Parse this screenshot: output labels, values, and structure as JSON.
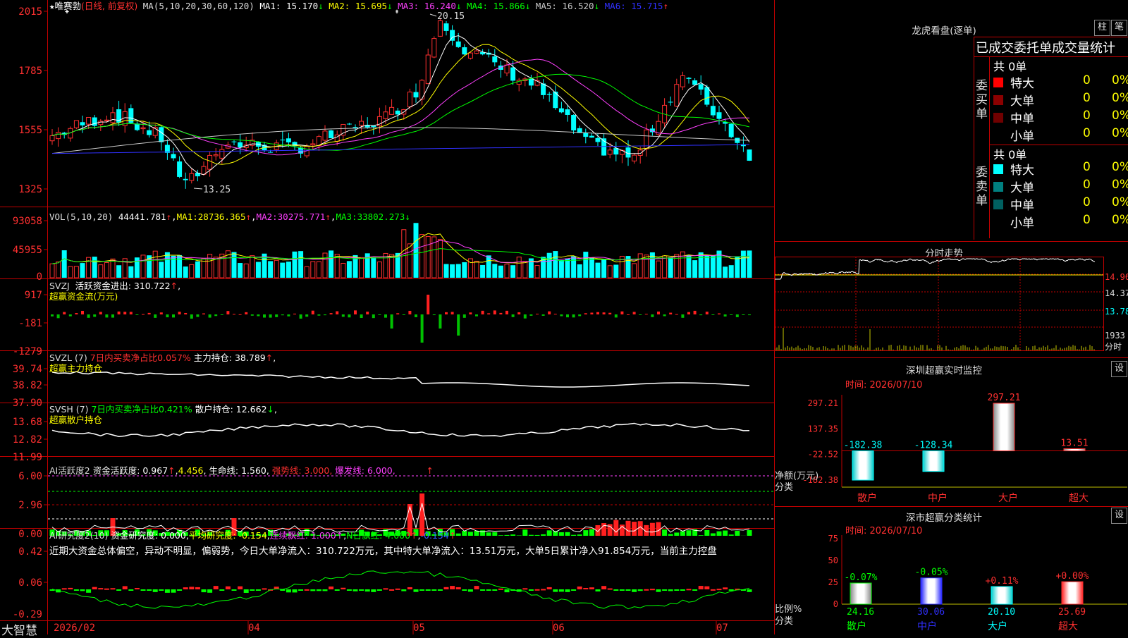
{
  "app": {
    "logo": "大智慧"
  },
  "kline": {
    "stock_name": "唯赛勃",
    "period": "(日线, 前复权)",
    "ma_label": "MA(5,10,20,30,60,120)",
    "ma": [
      {
        "label": "MA1:",
        "value": "15.170",
        "arrow": "↓",
        "color": "#ffffff"
      },
      {
        "label": "MA2:",
        "value": "15.695",
        "arrow": "↓",
        "color": "#ffff00"
      },
      {
        "label": "MA3:",
        "value": "16.240",
        "arrow": "↓",
        "color": "#ff40ff"
      },
      {
        "label": "MA4:",
        "value": "15.866",
        "arrow": "↓",
        "color": "#00ff00"
      },
      {
        "label": "MA5:",
        "value": "16.520",
        "arrow": "↓",
        "color": "#c8c8c8"
      },
      {
        "label": "MA6:",
        "value": "15.715",
        "arrow": "↑",
        "color": "#3030ff"
      }
    ],
    "y_ticks": [
      "2015",
      "1785",
      "1555",
      "1325"
    ],
    "high_label": "20.15",
    "low_label": "13.25"
  },
  "vol": {
    "label": "VOL(5,10,20)",
    "value": "44441.781",
    "ma1_label": "MA1:",
    "ma1": "28736.365",
    "ma2_label": "MA2:",
    "ma2": "30275.771",
    "ma3_label": "MA3:",
    "ma3": "33802.273",
    "y_ticks": [
      "93058",
      "45955",
      "0"
    ]
  },
  "svzj": {
    "label": "SVZJ",
    "text": "活跃资金进出: 310.722",
    "subtitle": "超赢资金流(万元)",
    "y_ticks": [
      "917",
      "-181",
      "-1279"
    ]
  },
  "svzl": {
    "label": "SVZL (7)",
    "red_text": "7日内买卖净占比0.057%",
    "white_text": "主力持仓: 38.789",
    "subtitle": "超赢主力持仓",
    "y_ticks": [
      "39.74",
      "38.82",
      "37.90"
    ]
  },
  "svsh": {
    "label": "SVSH (7)",
    "green_text": "7日内买卖净占比0.421%",
    "white_text": "散户持仓: 12.662",
    "subtitle": "超赢散户持仓",
    "y_ticks": [
      "13.68",
      "12.82",
      "11.99"
    ]
  },
  "ai_active": {
    "label": "AI活跃度2",
    "t1": "资金活跃度: 0.967",
    "t2": "4.456",
    "t3": "生命线: 1.560",
    "t4": "强势线: 3.000",
    "t5": "爆发线: 6.000",
    "y_ticks": [
      "6.00",
      "2.96",
      "0.00"
    ]
  },
  "ai_research": {
    "label": "AI研究度2(10)",
    "t1": "资金研究度: 0.000",
    "t2": "平均研究度: -0.154",
    "t3": "连续飘红: 1.000",
    "t4": "N日飘红: 4.000",
    "t5": "-0.154",
    "comment": "近期大资金总体偏空，异动不明显，偏弱势，今日大单净流入：310.722万元，其中特大单净流入：13.51万元，大单5日累计净入91.854万元，当前主力控盘",
    "y_ticks": [
      "0.42",
      "0.06",
      "-0.29"
    ]
  },
  "x_axis": [
    "2026/02",
    "04",
    "05",
    "06",
    "07"
  ],
  "right": {
    "lhb_title": "龙虎看盘(逐单)",
    "btn_zhu": "柱",
    "btn_bi": "笔",
    "stats_header": "已成交委托单成交量统计",
    "buy": {
      "side_label": "委买单",
      "total": "共 0单",
      "rows": [
        {
          "name": "特大",
          "count": "0",
          "pct": "0%"
        },
        {
          "name": "大单",
          "count": "0",
          "pct": "0%"
        },
        {
          "name": "中单",
          "count": "0",
          "pct": "0%"
        },
        {
          "name": "小单",
          "count": "0",
          "pct": "0%"
        }
      ]
    },
    "sell": {
      "side_label": "委卖单",
      "total": "共 0单",
      "rows": [
        {
          "name": "特大",
          "count": "0",
          "pct": "0%"
        },
        {
          "name": "大单",
          "count": "0",
          "pct": "0%"
        },
        {
          "name": "中单",
          "count": "0",
          "pct": "0%"
        },
        {
          "name": "小单",
          "count": "0",
          "pct": "0%"
        }
      ]
    },
    "fenshi": {
      "title": "分时走势",
      "prices": [
        "14.96",
        "14.37",
        "13.78"
      ],
      "vol": "1933",
      "vol_label": "分时"
    },
    "sz_monitor": {
      "title": "深圳超赢实时监控",
      "btn": "设",
      "time": "时间: 2026/07/10",
      "y_ticks": [
        "297.21",
        "137.35",
        "-22.52",
        "-182.38"
      ],
      "y_label": "净额(万元)",
      "x_label": "分类"
    },
    "sz_class": {
      "title": "深市超赢分类统计",
      "btn": "设",
      "time": "时间: 2026/07/10",
      "y_ticks": [
        "75",
        "50",
        "25",
        "0"
      ],
      "y_label": "比例%",
      "x_label": "分类"
    }
  },
  "chart_data": [
    {
      "type": "bar",
      "title": "深圳超赢实时监控",
      "ylabel": "净额(万元)",
      "xlabel": "分类",
      "categories": [
        "散户",
        "中户",
        "大户",
        "超大"
      ],
      "values": [
        -182.38,
        -128.34,
        297.21,
        13.51
      ],
      "ylim": [
        -182.38,
        297.21
      ]
    },
    {
      "type": "bar",
      "title": "深市超赢分类统计",
      "ylabel": "比例%",
      "xlabel": "分类",
      "categories": [
        "散户",
        "中户",
        "大户",
        "超大"
      ],
      "values": [
        24.16,
        30.06,
        20.1,
        25.69
      ],
      "changes": [
        "-0.07%",
        "-0.05%",
        "+0.11%",
        "+0.00%"
      ],
      "change_colors": [
        "#00ff00",
        "#00ff00",
        "#ff3030",
        "#ff3030"
      ],
      "ylim": [
        0,
        75
      ]
    }
  ]
}
